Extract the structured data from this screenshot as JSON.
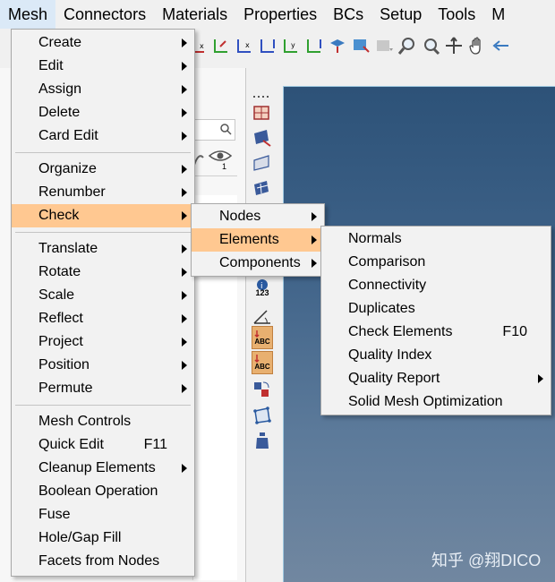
{
  "menubar": {
    "items": [
      "Mesh",
      "Connectors",
      "Materials",
      "Properties",
      "BCs",
      "Setup",
      "Tools",
      "M"
    ]
  },
  "toolbar": {
    "icons": [
      "axis-x-icon",
      "axis-y-icon",
      "axis-z-icon",
      "axis-zx-icon",
      "axis-yz-icon",
      "axis-xy-icon",
      "render-icon",
      "render-toggle-icon",
      "zoom-in-icon",
      "zoom-fit-icon",
      "pan-icon",
      "hand-icon",
      "back-arrow-icon"
    ]
  },
  "panel": {
    "eye_badge": "1"
  },
  "vstrip": {
    "info_number": "123",
    "abc_label_1": "ABC",
    "abc_label_2": "ABC"
  },
  "mesh_menu": {
    "group1": [
      {
        "label": "Create",
        "submenu": true
      },
      {
        "label": "Edit",
        "submenu": true
      },
      {
        "label": "Assign",
        "submenu": true
      },
      {
        "label": "Delete",
        "submenu": true
      },
      {
        "label": "Card Edit",
        "submenu": true
      }
    ],
    "group2": [
      {
        "label": "Organize",
        "submenu": true
      },
      {
        "label": "Renumber",
        "submenu": true
      },
      {
        "label": "Check",
        "submenu": true,
        "highlighted": true
      }
    ],
    "group3": [
      {
        "label": "Translate",
        "submenu": true
      },
      {
        "label": "Rotate",
        "submenu": true
      },
      {
        "label": "Scale",
        "submenu": true
      },
      {
        "label": "Reflect",
        "submenu": true
      },
      {
        "label": "Project",
        "submenu": true
      },
      {
        "label": "Position",
        "submenu": true
      },
      {
        "label": "Permute",
        "submenu": true
      }
    ],
    "group4": [
      {
        "label": "Mesh Controls",
        "submenu": false
      },
      {
        "label": "Quick Edit",
        "shortcut": "F11",
        "submenu": false
      },
      {
        "label": "Cleanup Elements",
        "submenu": true
      },
      {
        "label": "Boolean Operation",
        "submenu": false
      },
      {
        "label": "Fuse",
        "submenu": false
      },
      {
        "label": "Hole/Gap Fill",
        "submenu": false
      },
      {
        "label": "Facets from Nodes",
        "submenu": false
      }
    ]
  },
  "check_menu": {
    "items": [
      {
        "label": "Nodes",
        "submenu": true
      },
      {
        "label": "Elements",
        "submenu": true,
        "highlighted": true
      },
      {
        "label": "Components",
        "submenu": true
      }
    ]
  },
  "elements_menu": {
    "items": [
      {
        "label": "Normals"
      },
      {
        "label": "Comparison"
      },
      {
        "label": "Connectivity"
      },
      {
        "label": "Duplicates"
      },
      {
        "label": "Check Elements",
        "shortcut": "F10"
      },
      {
        "label": "Quality Index"
      },
      {
        "label": "Quality Report",
        "submenu": true
      },
      {
        "label": "Solid Mesh Optimization"
      }
    ]
  },
  "watermark": "知乎 @翔DICO",
  "colors": {
    "highlight": "#ffc891",
    "menu_bg": "#f2f2f2",
    "viewport_top": "#2d5278",
    "viewport_bottom": "#7187a0"
  }
}
